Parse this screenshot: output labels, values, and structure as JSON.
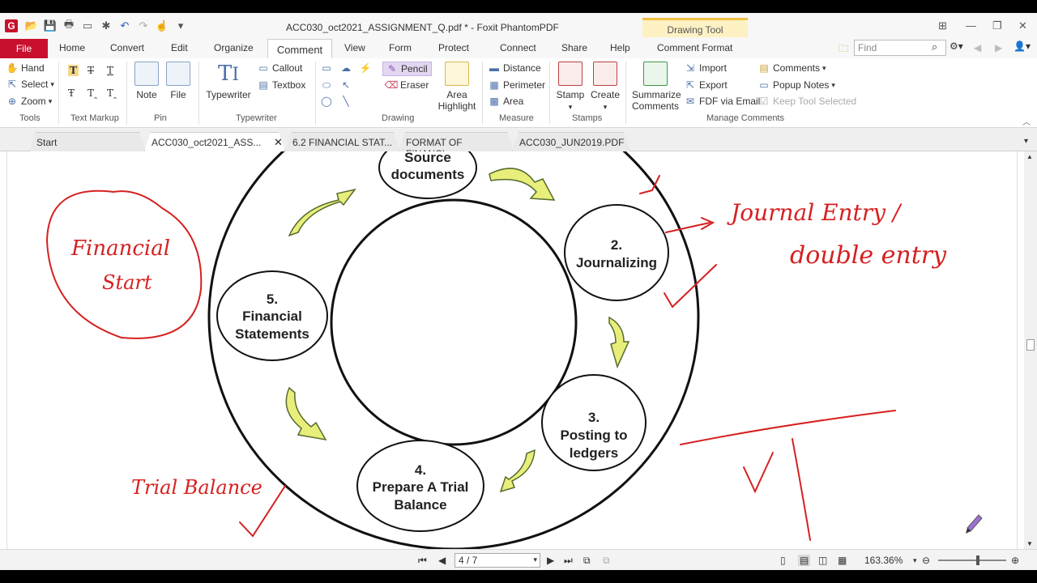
{
  "window": {
    "title": "ACC030_oct2021_ASSIGNMENT_Q.pdf * - Foxit PhantomPDF",
    "context_tab": "Drawing Tool"
  },
  "ribbon_tabs": [
    "File",
    "Home",
    "Convert",
    "Edit",
    "Organize",
    "Comment",
    "View",
    "Form",
    "Protect",
    "Connect",
    "Share",
    "Help",
    "Comment Format"
  ],
  "active_tab": "Comment",
  "search": {
    "placeholder": "Find"
  },
  "ribbon": {
    "tools": {
      "hand": "Hand",
      "select": "Select",
      "zoom": "Zoom",
      "group": "Tools"
    },
    "text_markup": {
      "group": "Text Markup"
    },
    "pin": {
      "note": "Note",
      "file": "File",
      "group": "Pin"
    },
    "typewriter": {
      "typewriter": "Typewriter",
      "callout": "Callout",
      "textbox": "Textbox",
      "group": "Typewriter"
    },
    "drawing": {
      "pencil": "Pencil",
      "eraser": "Eraser",
      "area_highlight_1": "Area",
      "area_highlight_2": "Highlight",
      "group": "Drawing"
    },
    "measure": {
      "distance": "Distance",
      "perimeter": "Perimeter",
      "area": "Area",
      "group": "Measure"
    },
    "stamps": {
      "stamp": "Stamp",
      "create": "Create",
      "group": "Stamps"
    },
    "manage": {
      "summarize_1": "Summarize",
      "summarize_2": "Comments",
      "import": "Import",
      "export": "Export",
      "fdf_email": "FDF via Email",
      "comments": "Comments",
      "popup_notes": "Popup Notes",
      "keep_tool": "Keep Tool Selected",
      "group": "Manage Comments"
    }
  },
  "doc_tabs": [
    "Start",
    "ACC030_oct2021_ASS...",
    "6.2 FINANCIAL STAT...",
    "FORMAT OF FINANCI...",
    "ACC030_JUN2019.PDF"
  ],
  "active_doc_tab": 1,
  "diagram": {
    "node_source_1": "Source",
    "node_source_2": "documents",
    "node_2_num": "2.",
    "node_2_label": "Journalizing",
    "node_3_num": "3.",
    "node_3_label_1": "Posting to",
    "node_3_label_2": "ledgers",
    "node_4_num": "4.",
    "node_4_label_1": "Prepare A Trial",
    "node_4_label_2": "Balance",
    "node_5_num": "5.",
    "node_5_label_1": "Financial",
    "node_5_label_2": "Statements"
  },
  "handwriting": {
    "financial_1": "Financial",
    "financial_2": "Start",
    "journal": "Journal Entry /",
    "double": "double entry",
    "trial": "Trial Balance"
  },
  "status": {
    "page": "4 / 7",
    "zoom": "163.36%"
  }
}
